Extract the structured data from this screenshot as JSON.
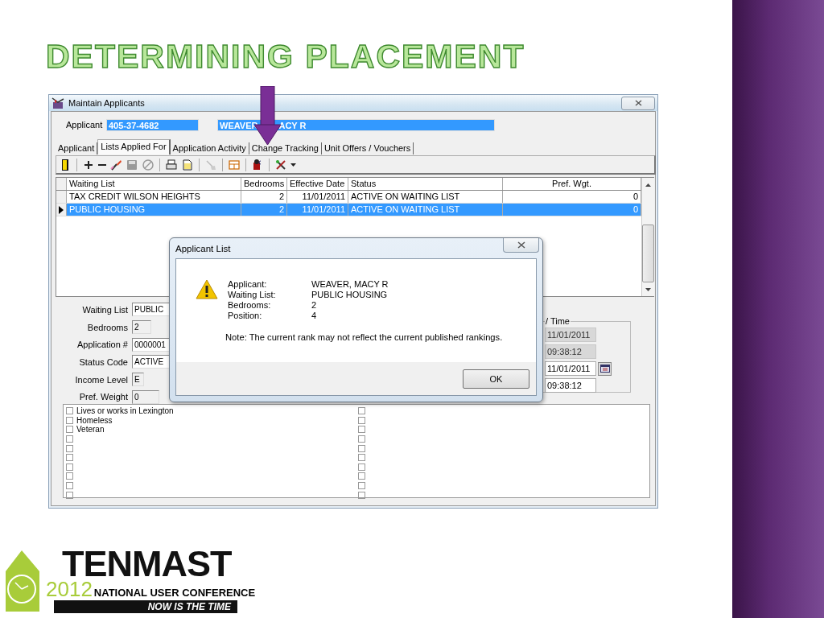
{
  "slide": {
    "title": "DETERMINING PLACEMENT"
  },
  "window": {
    "title": "Maintain Applicants",
    "applicant": {
      "label": "Applicant",
      "id": "405-37-4682",
      "name_parts": [
        "WEAVER",
        "ACY R"
      ]
    },
    "tabs": [
      {
        "label": "Applicant",
        "selected": false
      },
      {
        "label": "Lists Applied For",
        "selected": true
      },
      {
        "label": "Application Activity",
        "selected": false
      },
      {
        "label": "Change Tracking",
        "selected": false
      },
      {
        "label": "Unit Offers / Vouchers",
        "selected": false
      }
    ],
    "grid": {
      "columns": [
        "Waiting List",
        "Bedrooms",
        "Effective Date",
        "Status",
        "Pref. Wgt."
      ],
      "rows": [
        {
          "cells": [
            "TAX CREDIT WILSON HEIGHTS",
            "2",
            "11/01/2011",
            "ACTIVE ON WAITING LIST",
            "0"
          ],
          "selected": false
        },
        {
          "cells": [
            "PUBLIC HOUSING",
            "2",
            "11/01/2011",
            "ACTIVE ON WAITING LIST",
            "0"
          ],
          "selected": true
        }
      ]
    },
    "details": {
      "fields": [
        {
          "label": "Waiting List",
          "value": "PUBLIC"
        },
        {
          "label": "Bedrooms",
          "value": "2"
        },
        {
          "label": "Application #",
          "value": "0000001"
        },
        {
          "label": "Status Code",
          "value": "ACTIVE"
        },
        {
          "label": "Income Level",
          "value": "E"
        },
        {
          "label": "Pref. Weight",
          "value": "0"
        }
      ],
      "date_group": {
        "title": "/ Time",
        "fields": [
          {
            "value": "11/01/2011",
            "readonly": true,
            "calendar": false
          },
          {
            "value": "09:38:12",
            "readonly": true,
            "calendar": false
          },
          {
            "value": "11/01/2011",
            "readonly": false,
            "calendar": true
          },
          {
            "value": "09:38:12",
            "readonly": false,
            "calendar": false
          }
        ]
      }
    },
    "preferences": {
      "columns": [
        [
          {
            "label": "Lives or works in Lexington",
            "checked": false
          },
          {
            "label": "Homeless",
            "checked": false
          },
          {
            "label": "Veteran",
            "checked": false
          },
          {
            "checked": false
          },
          {
            "checked": false
          },
          {
            "checked": false
          },
          {
            "checked": false
          },
          {
            "checked": false
          },
          {
            "checked": false
          },
          {
            "checked": false
          }
        ],
        [
          {
            "checked": false
          },
          {
            "checked": false
          },
          {
            "checked": false
          },
          {
            "checked": false
          },
          {
            "checked": false
          },
          {
            "checked": false
          },
          {
            "checked": false
          },
          {
            "checked": false
          },
          {
            "checked": false
          },
          {
            "checked": false
          }
        ]
      ]
    }
  },
  "dialog": {
    "title": "Applicant List",
    "rows": [
      {
        "label": "Applicant:",
        "value": "WEAVER, MACY R"
      },
      {
        "label": "Waiting List:",
        "value": "PUBLIC HOUSING"
      },
      {
        "label": "Bedrooms:",
        "value": "2"
      },
      {
        "label": "Position:",
        "value": "4"
      }
    ],
    "note": "Note: The current rank may not reflect the current published rankings.",
    "button": "OK"
  },
  "logo": {
    "name": "TENMAST",
    "year": "2012",
    "subtitle": "NATIONAL USER CONFERENCE",
    "tagline": "NOW IS THE TIME"
  }
}
